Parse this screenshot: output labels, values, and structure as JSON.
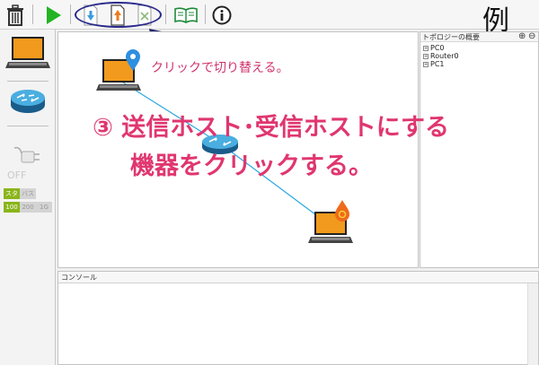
{
  "toolbar": {
    "buttons": [
      {
        "name": "trash-icon"
      },
      {
        "name": "play-icon"
      },
      {
        "name": "set-sender-icon"
      },
      {
        "name": "set-receiver-icon"
      },
      {
        "name": "clear-endpoints-icon"
      },
      {
        "name": "open-book-icon"
      },
      {
        "name": "info-icon"
      }
    ],
    "example_label": "例",
    "zoom_in": "⊕",
    "zoom_out": "⊖"
  },
  "palette": {
    "power_label": "OFF",
    "mode_options": [
      "スター",
      "バス"
    ],
    "speed_options": [
      "100",
      "200",
      "1G"
    ]
  },
  "tree": {
    "title": "トポロジーの概要",
    "items": [
      "PC0",
      "Router0",
      "PC1"
    ]
  },
  "console": {
    "title": "コンソール"
  },
  "annotations": {
    "small": "クリックで切り替える。",
    "big_line1": "③ 送信ホスト･受信ホストにする",
    "big_line2": "機器をクリックする。"
  },
  "colors": {
    "accent_pink": "#e0366f",
    "sender_pin": "#2f8fe0",
    "receiver_pin": "#ef6a1a",
    "link_line": "#2ba7e0"
  }
}
